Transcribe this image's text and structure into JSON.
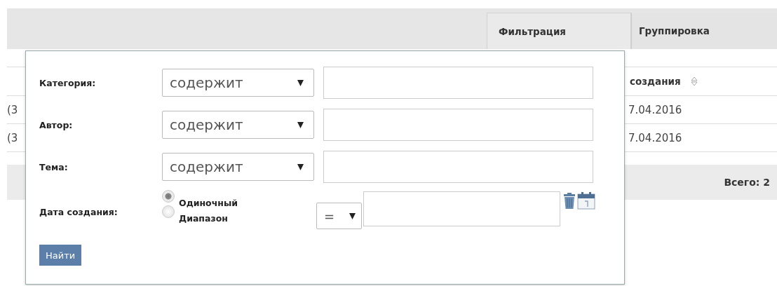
{
  "tabs": [
    {
      "label": "Фильтрация",
      "selected": true
    },
    {
      "label": "Группировка",
      "selected": false
    }
  ],
  "table": {
    "columns": [
      "",
      "создания"
    ],
    "rows": [
      {
        "cells": [
          "(3",
          "7.04.2016"
        ]
      },
      {
        "cells": [
          "(3",
          "7.04.2016"
        ]
      }
    ],
    "footer": "Всего: 2"
  },
  "filter": {
    "fields": [
      {
        "kind": "text",
        "label": "Категория:",
        "operator": "содержит"
      },
      {
        "kind": "text",
        "label": "Автор:",
        "operator": "содержит"
      },
      {
        "kind": "text",
        "label": "Тема:",
        "operator": "содержит"
      },
      {
        "kind": "date",
        "label": "Дата создания:",
        "operator": "=",
        "modes": [
          {
            "label": "Одиночный",
            "selected": true
          },
          {
            "label": "Диапазон",
            "selected": false
          }
        ]
      }
    ],
    "submit": "Найти"
  }
}
